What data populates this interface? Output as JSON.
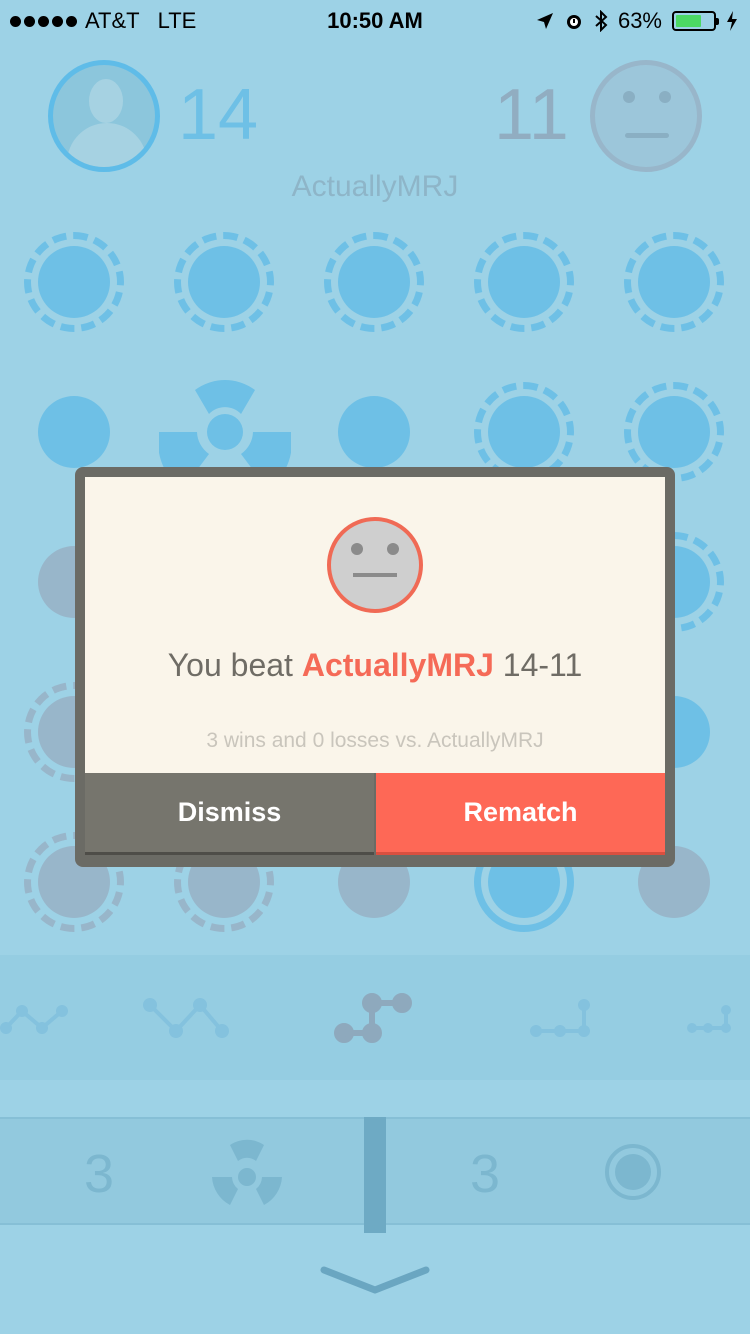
{
  "status_bar": {
    "carrier": "AT&T",
    "network": "LTE",
    "time": "10:50 AM",
    "battery_percent": "63%",
    "battery_level": 0.63
  },
  "game": {
    "my_score": "14",
    "opponent_score": "11",
    "opponent_name": "ActuallyMRJ",
    "tray_counts": [
      "3",
      "3"
    ]
  },
  "dialog": {
    "result_prefix": "You beat",
    "opponent": "ActuallyMRJ",
    "result_score": "14-11",
    "record": "3 wins and 0 losses vs. ActuallyMRJ",
    "dismiss_label": "Dismiss",
    "rematch_label": "Rematch"
  },
  "colors": {
    "accent": "#fe6856",
    "dismiss": "#76756d",
    "background": "#9dd2e6"
  }
}
